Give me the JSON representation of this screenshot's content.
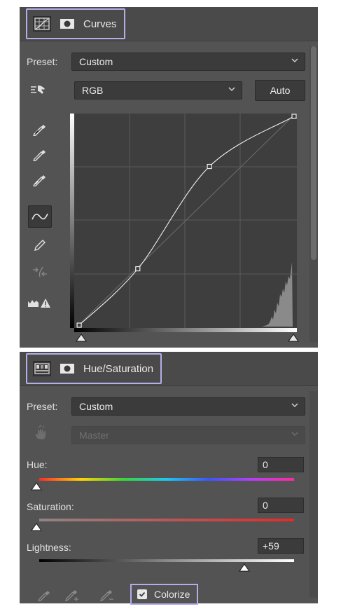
{
  "curves": {
    "title": "Curves",
    "preset_label": "Preset:",
    "preset_value": "Custom",
    "channel_value": "RGB",
    "auto_label": "Auto",
    "points": [
      [
        0.01,
        0.0
      ],
      [
        0.28,
        0.27
      ],
      [
        0.61,
        0.76
      ],
      [
        1.0,
        1.0
      ]
    ]
  },
  "hue_sat": {
    "title": "Hue/Saturation",
    "preset_label": "Preset:",
    "preset_value": "Custom",
    "range_value": "Master",
    "hue_label": "Hue:",
    "hue_value": "0",
    "saturation_label": "Saturation:",
    "saturation_value": "0",
    "lightness_label": "Lightness:",
    "lightness_value": "+59",
    "colorize_label": "Colorize",
    "colorize_checked": true
  }
}
